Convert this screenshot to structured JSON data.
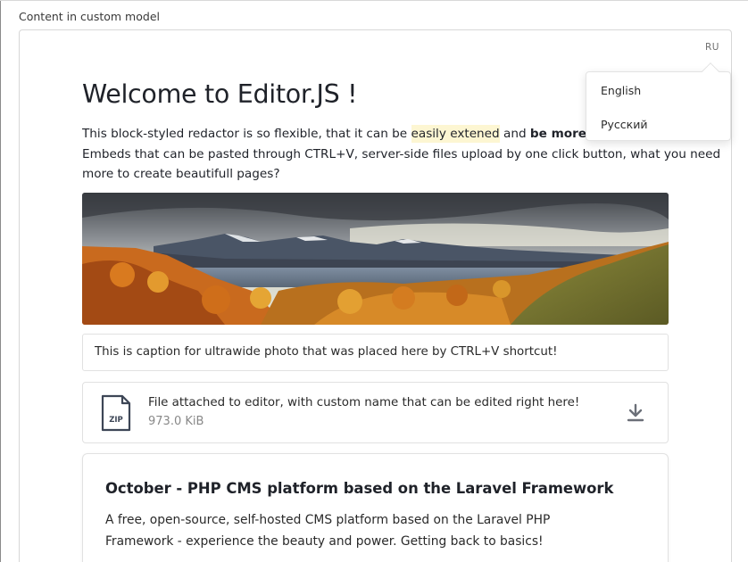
{
  "section_label": "Content in custom model",
  "lang_toggle": "RU",
  "lang_menu": {
    "options": [
      "English",
      "Русский"
    ]
  },
  "editor": {
    "title": "Welcome to Editor.JS !",
    "paragraph": {
      "l1_a": "This block-styled redactor is so flexible, that it can be ",
      "l1_marker": "easily extened",
      "l1_b": " and ",
      "l1_bold": "be more powerful",
      "l2": "Embeds that can be pasted through CTRL+V, server-side files upload by one click button, what you need",
      "l3": "more to create beautifull pages?"
    },
    "image": {
      "icon": "landscape-photo"
    },
    "caption": "This is caption for ultrawide photo that was placed here by CTRL+V shortcut!",
    "attachment": {
      "icon": "zip-file-icon",
      "icon_label": "ZIP",
      "title": "File attached to editor, with custom name that can be edited right here!",
      "size": "973.0 KiB",
      "download_icon": "download-icon"
    },
    "link_card": {
      "title": "October - PHP CMS platform based on the Laravel Framework",
      "desc_l1": "A free, open-source, self-hosted CMS platform based on the Laravel PHP",
      "desc_l2": "Framework - experience the beauty and power. Getting back to basics!"
    }
  },
  "colors": {
    "accent_marker": "#fdf6d2",
    "text": "#1f2229",
    "border": "#e1e1e1"
  }
}
